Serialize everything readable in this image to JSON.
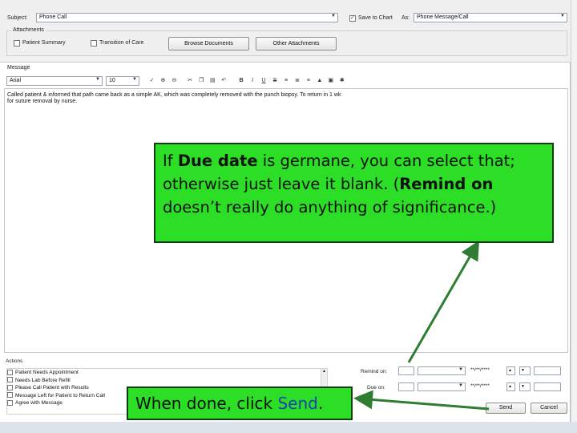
{
  "form": {
    "subject_label": "Subject:",
    "subject_value": "Phone Call",
    "save_to_chart_label": "Save to Chart",
    "save_to_chart_checked": true,
    "as_label": "As:",
    "as_value": "Phone Message/Call",
    "attachments_label": "Attachments",
    "attachments": [
      {
        "label": "Patient Summary",
        "checked": false
      },
      {
        "label": "Transition of Care",
        "checked": false
      }
    ],
    "browse_documents_label": "Browse Documents",
    "other_attachments_label": "Other Attachments"
  },
  "message": {
    "label": "Message",
    "font_value": "Arial",
    "size_value": "10",
    "toolbar_icons": [
      "zoom-in-icon",
      "zoom-out-icon",
      "spellcheck-icon",
      "cut-icon",
      "copy-icon",
      "paste-icon",
      "bold-icon",
      "italic-icon",
      "underline-icon",
      "strikethrough-icon",
      "align-left-icon",
      "align-center-icon",
      "align-right-icon",
      "text-color-icon",
      "image-icon",
      "special-icon"
    ],
    "body_line1": "Called patient & informed that path came back as a simple AK, which was completely removed with the punch biopsy.  To return in 1 wk",
    "body_line2": "for suture removal by nurse."
  },
  "actions": {
    "label": "Actions",
    "items": [
      "Patient Needs Appointment",
      "Needs Lab Before Refill",
      "Please Call Patient with Results",
      "Message Left for Patient to Return Call",
      "Agree with Message"
    ],
    "remind_on_label": "Remind on:",
    "due_on_label": "Due on:",
    "date_placeholder": "**/**/****",
    "send_label": "Send",
    "cancel_label": "Cancel"
  },
  "callouts": {
    "top": {
      "prefix": "If ",
      "due_date": "Due date",
      "middle": " is germane, you can select that; otherwise just leave it blank. (",
      "remind_on": "Remind on",
      "suffix": " doesn’t really do anything of significance.)"
    },
    "bottom": {
      "prefix": "When done, click ",
      "send_word": "Send",
      "suffix": "."
    }
  },
  "colors": {
    "callout_fill": "#2cde26",
    "arrow": "#2e7d32",
    "send_word": "#1f3fb5"
  }
}
